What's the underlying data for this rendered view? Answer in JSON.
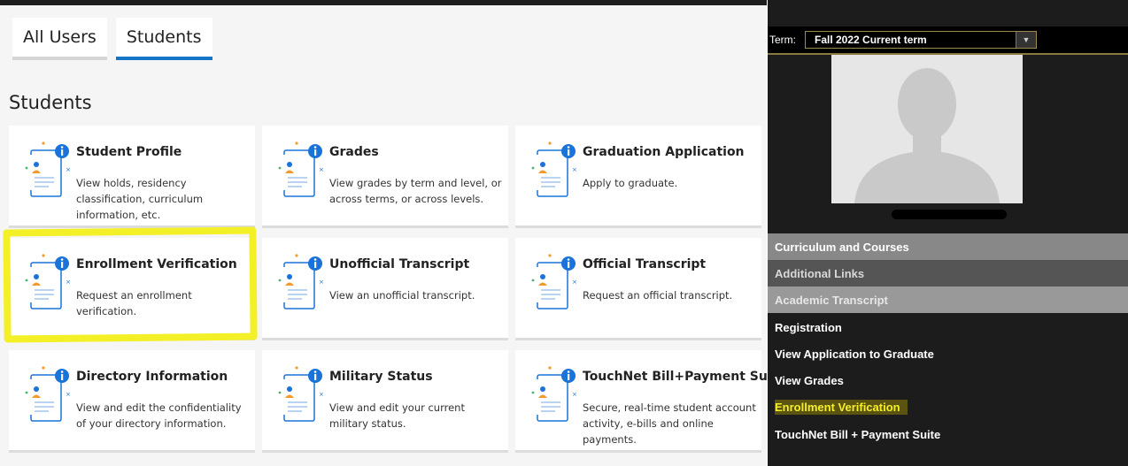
{
  "tabs": [
    {
      "label": "All Users"
    },
    {
      "label": "Students"
    }
  ],
  "section_title": "Students",
  "cards": [
    {
      "title": "Student Profile",
      "desc": "View holds, residency classification, curriculum information, etc."
    },
    {
      "title": "Grades",
      "desc": "View grades by term and level, or across terms, or across levels."
    },
    {
      "title": "Graduation Application",
      "desc": "Apply to graduate."
    },
    {
      "title": "Enrollment Verification",
      "desc": "Request an enrollment verification."
    },
    {
      "title": "Unofficial Transcript",
      "desc": "View an unofficial transcript."
    },
    {
      "title": "Official Transcript",
      "desc": "Request an official transcript."
    },
    {
      "title": "Directory Information",
      "desc": "View and edit the confidentiality of your directory information."
    },
    {
      "title": "Military Status",
      "desc": "View and edit your current military status."
    },
    {
      "title": "TouchNet Bill+Payment Suite",
      "desc": "Secure, real-time student account activity, e-bills and online payments."
    }
  ],
  "right": {
    "term_label": "Term:",
    "term_value": "Fall 2022 Current term",
    "nav": [
      {
        "label": "Curriculum and Courses"
      },
      {
        "label": "Additional Links"
      },
      {
        "label": "Academic Transcript"
      },
      {
        "label": "Registration"
      },
      {
        "label": "View Application to Graduate"
      },
      {
        "label": "View Grades"
      },
      {
        "label": "Enrollment Verification"
      },
      {
        "label": "TouchNet Bill + Payment Suite"
      }
    ]
  },
  "colors": {
    "tab_active": "#1475c6",
    "highlight": "#f3f028",
    "icon_blue": "#1a73d9",
    "nav_highlight_text": "#f6ee2a"
  },
  "icons": {
    "card_icon": "student-document-info-icon",
    "dropdown": "chevron-down-icon",
    "photo": "avatar-silhouette-icon"
  }
}
